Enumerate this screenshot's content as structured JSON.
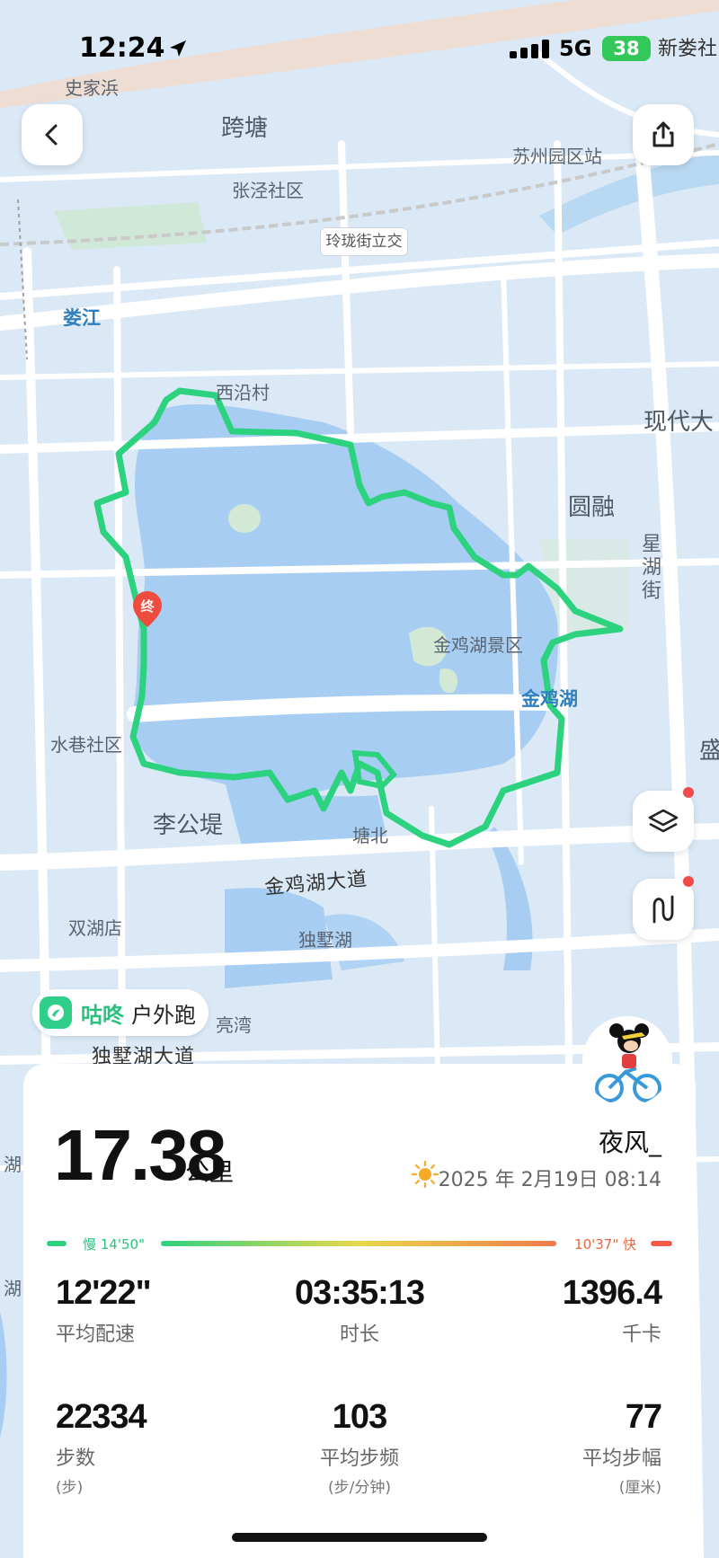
{
  "status_bar": {
    "time": "12:24",
    "network": "5G",
    "battery": "38",
    "carrier_overlay": "新娄社"
  },
  "map": {
    "labels": {
      "shijiabang": "史家浜",
      "kuatang": "跨塘",
      "suzhou_yuanqu": "苏州园区站",
      "zhangjing": "张泾社区",
      "linglong": "玲珑街立交",
      "loujiang": "娄江",
      "xiyan": "西沿村",
      "xiandai": "现代大",
      "yuanrong": "圆融",
      "xinghu": "星湖街",
      "jinji_scenic": "金鸡湖景区",
      "jinji_lake": "金鸡湖",
      "shuixiang": "水巷社区",
      "sheng": "盛",
      "ligongdi": "李公堤",
      "tangbei": "塘北",
      "jinji_road": "金鸡湖大道",
      "shuanghu": "双湖店",
      "dushu_lake": "独墅湖",
      "liangwan": "亮湾",
      "dushu_road": "独墅湖大道",
      "hu_left": "湖",
      "hu_left2": "湖"
    },
    "end_marker": "终"
  },
  "activity": {
    "brand_name": "咕咚",
    "mode": "户外跑",
    "distance": "17.38",
    "distance_unit": "公里",
    "user_name": "夜风_",
    "datetime": "2025 年 2月19日 08:14",
    "pace_slow_label": "慢 14'50\"",
    "pace_fast_label": "10'37\" 快",
    "stats": [
      {
        "value": "12'22\"",
        "label": "平均配速",
        "unit": ""
      },
      {
        "value": "03:35:13",
        "label": "时长",
        "unit": ""
      },
      {
        "value": "1396.4",
        "label": "千卡",
        "unit": ""
      },
      {
        "value": "22334",
        "label": "步数",
        "unit": "(步)"
      },
      {
        "value": "103",
        "label": "平均步频",
        "unit": "(步/分钟)"
      },
      {
        "value": "77",
        "label": "平均步幅",
        "unit": "(厘米)"
      }
    ]
  },
  "colors": {
    "route": "#2dd27f",
    "brand": "#2cc07e",
    "pace_slow": "#2dd27f",
    "pace_fast": "#f25a4a"
  },
  "icons": [
    "back-icon",
    "share-icon",
    "layers-icon",
    "route-toggle-icon",
    "location-arrow-icon",
    "sun-icon",
    "end-marker-icon",
    "brand-logo-icon"
  ]
}
